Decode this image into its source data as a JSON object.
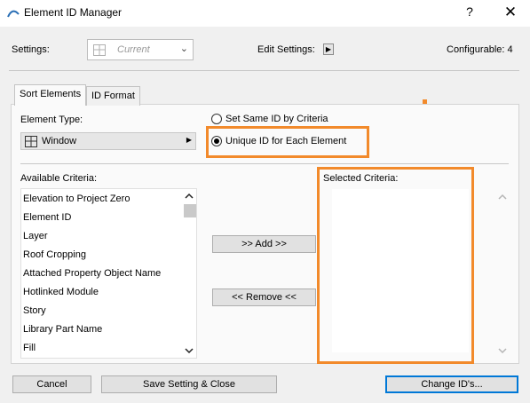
{
  "window": {
    "title": "Element ID Manager",
    "help": "?",
    "close": "✕"
  },
  "settings": {
    "label": "Settings:",
    "value": "Current",
    "edit_label": "Edit Settings:",
    "configurable": "Configurable: 4"
  },
  "tabs": [
    "Sort Elements",
    "ID Format"
  ],
  "element_type": {
    "label": "Element Type:",
    "value": "Window"
  },
  "radios": {
    "same_id": "Set Same ID by Criteria",
    "unique_id": "Unique ID for Each Element",
    "selected": "unique_id"
  },
  "available": {
    "label": "Available Criteria:",
    "items": [
      "Elevation to Project Zero",
      "Element ID",
      "Layer",
      "Roof Cropping",
      "Attached Property Object Name",
      "Hotlinked Module",
      "Story",
      "Library Part Name",
      "Fill"
    ]
  },
  "actions": {
    "add": ">> Add >>",
    "remove": "<< Remove <<"
  },
  "selected": {
    "label": "Selected Criteria:"
  },
  "footer": {
    "cancel": "Cancel",
    "save_close": "Save Setting & Close",
    "change_ids": "Change ID's..."
  },
  "colors": {
    "highlight": "#f28a2b",
    "focus": "#0078d7"
  }
}
